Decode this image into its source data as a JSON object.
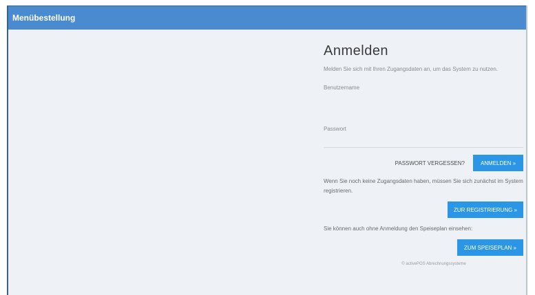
{
  "app": {
    "title": "Menübestellung"
  },
  "login": {
    "title": "Anmelden",
    "subtitle": "Melden Sie sich mit Ihren Zugangsdaten an, um das System zu nutzen.",
    "username_label": "Benutzername",
    "username_value": "",
    "password_label": "Passwort",
    "password_value": "",
    "forgot_link": "PASSWORT VERGESSEN?",
    "login_button": "ANMELDEN »"
  },
  "register": {
    "text": "Wenn Sie noch keine Zugangsdaten haben, müssen Sie sich zunächst im System registrieren.",
    "button": "ZUR REGISTRIERUNG »"
  },
  "menu": {
    "text": "Sie können auch ohne Anmeldung den Speiseplan einsehen:",
    "button": "ZUM SPEISEPLAN »"
  },
  "footer": {
    "text": "© activePOS Abrechnungssysteme"
  },
  "colors": {
    "header": "#4a8bd0",
    "button": "#2b95e6",
    "background": "#eef2f7"
  }
}
